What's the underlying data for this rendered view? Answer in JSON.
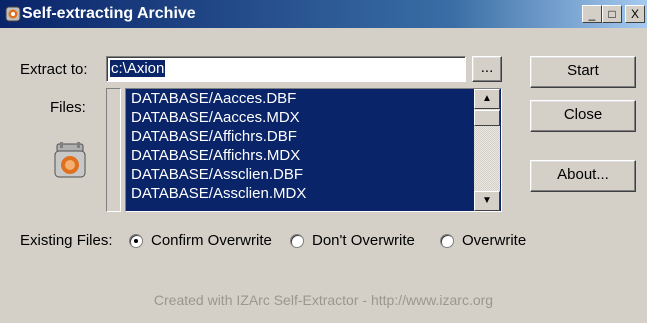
{
  "window": {
    "title": "Self-extracting Archive",
    "controls": {
      "minimize": "_",
      "maximize": "□",
      "close": "X"
    }
  },
  "extract": {
    "label": "Extract to:",
    "path": "c:\\Axion",
    "browse_label": "..."
  },
  "files": {
    "label": "Files:",
    "items": [
      "DATABASE/Aacces.DBF",
      "DATABASE/Aacces.MDX",
      "DATABASE/Affichrs.DBF",
      "DATABASE/Affichrs.MDX",
      "DATABASE/Assclien.DBF",
      "DATABASE/Assclien.MDX"
    ]
  },
  "buttons": {
    "start": "Start",
    "close": "Close",
    "about": "About..."
  },
  "existing": {
    "label": "Existing Files:",
    "options": [
      "Confirm Overwrite",
      "Don't Overwrite",
      "Overwrite"
    ],
    "selected": "Confirm Overwrite"
  },
  "footer": "Created with IZArc Self-Extractor - http://www.izarc.org",
  "colors": {
    "list_bg": "#0a246a",
    "titlebar": "#0a246a",
    "window_bg": "#d4d0c8",
    "logo_accent": "#e07020"
  },
  "icons": {
    "app": "izarc-logo-icon",
    "scroll_up": "arrow-up-icon",
    "scroll_down": "arrow-down-icon"
  }
}
